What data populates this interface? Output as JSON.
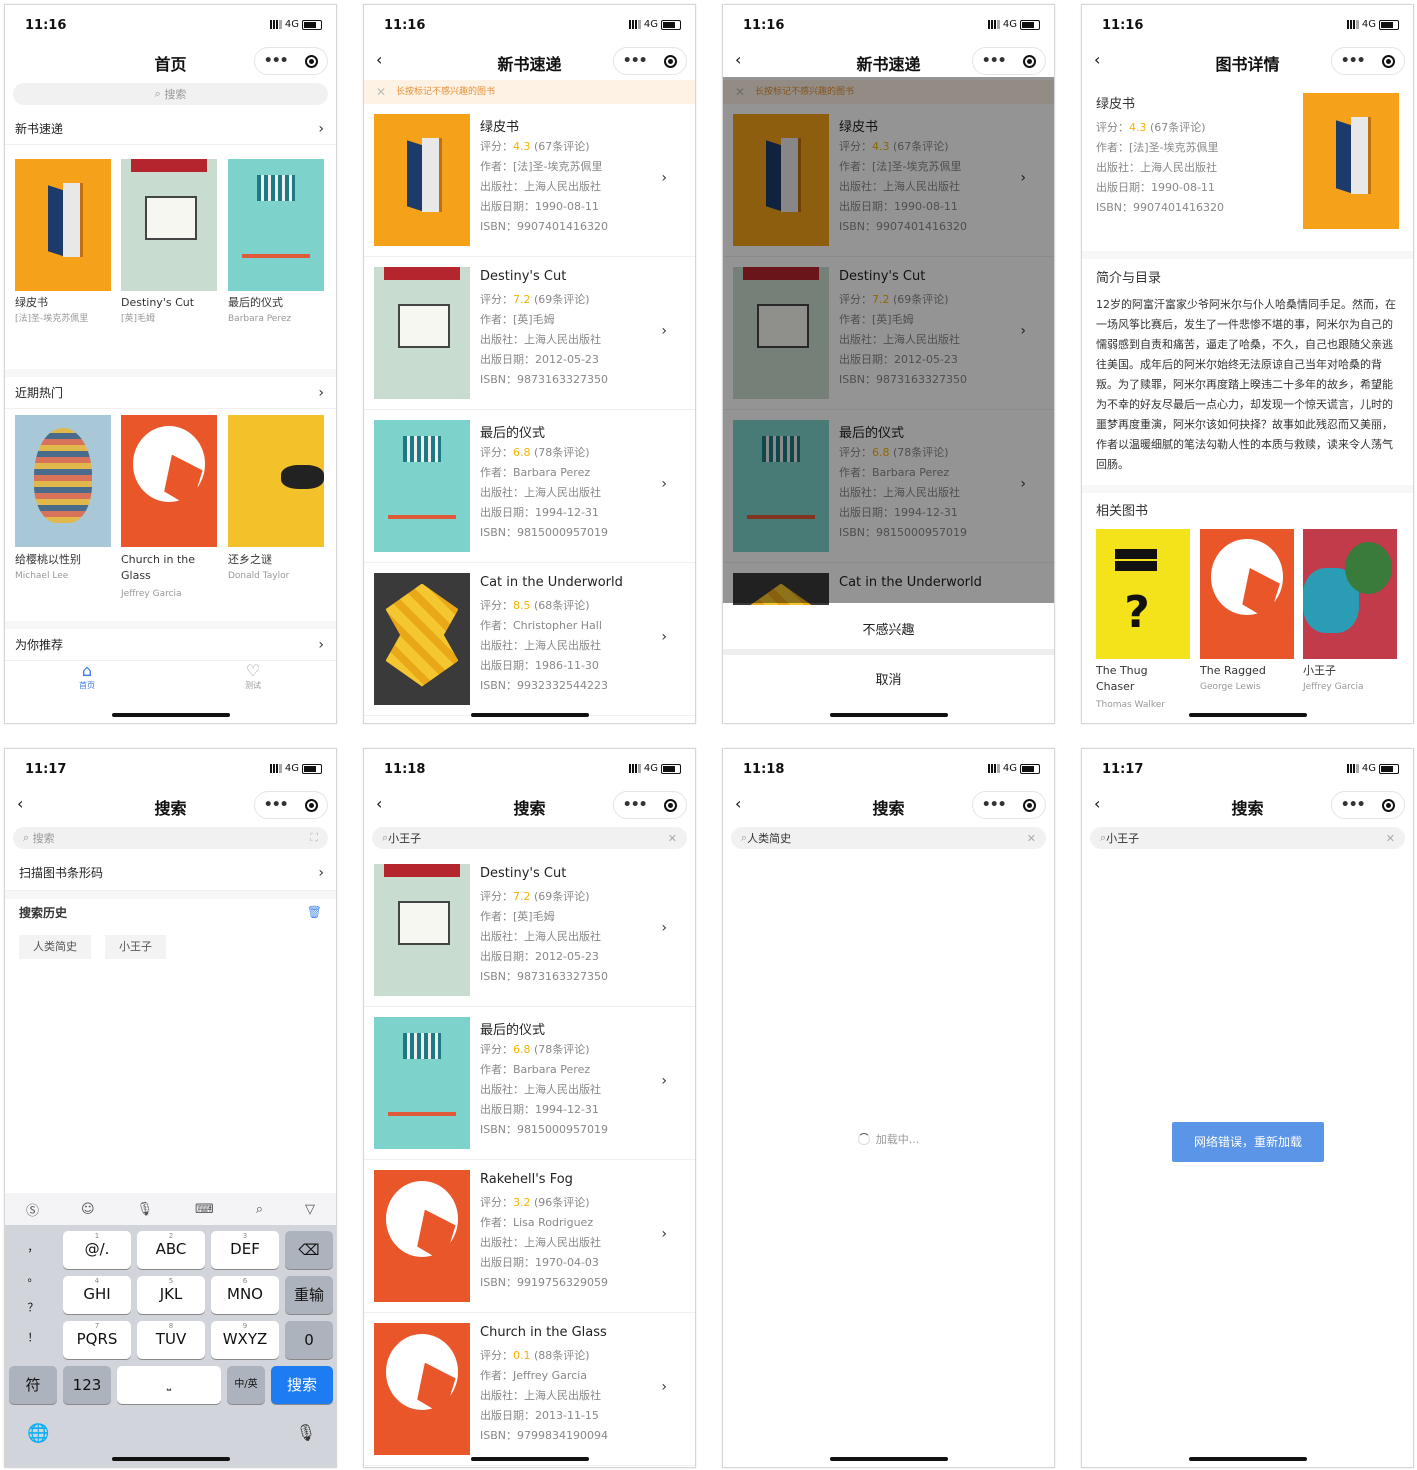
{
  "common": {
    "net": "4G",
    "more": "•••"
  },
  "p1": {
    "time": "11:16",
    "title": "首页",
    "search_placeholder": "搜索",
    "sec1": "新书速递",
    "sec2": "近期热门",
    "sec3": "为你推荐",
    "new": [
      {
        "title": "绿皮书",
        "author": "[法]圣-埃克苏佩里"
      },
      {
        "title": "Destiny's Cut",
        "author": "[英]毛姆"
      },
      {
        "title": "最后的仪式",
        "author": "Barbara Perez"
      }
    ],
    "hot": [
      {
        "title": "给樱桃以性别",
        "author": "Michael Lee"
      },
      {
        "title": "Church in the Glass",
        "author": "Jeffrey Garcia"
      },
      {
        "title": "还乡之谜",
        "author": "Donald Taylor"
      }
    ],
    "tabs": [
      "首页",
      "测试"
    ]
  },
  "p2": {
    "time": "11:16",
    "title": "新书速递",
    "notice": "长按标记不感兴趣的图书"
  },
  "list_new": [
    {
      "title": "绿皮书",
      "rate": "4.3",
      "reviews": "(67条评论)",
      "author": "[法]圣-埃克苏佩里",
      "publisher": "上海人民出版社",
      "date": "1990-08-11",
      "isbn": "9907401416320"
    },
    {
      "title": "Destiny's Cut",
      "rate": "7.2",
      "reviews": "(69条评论)",
      "author": "[英]毛姆",
      "publisher": "上海人民出版社",
      "date": "2012-05-23",
      "isbn": "9873163327350"
    },
    {
      "title": "最后的仪式",
      "rate": "6.8",
      "reviews": "(78条评论)",
      "author": "Barbara Perez",
      "publisher": "上海人民出版社",
      "date": "1994-12-31",
      "isbn": "9815000957019"
    },
    {
      "title": "Cat in the Underworld",
      "rate": "8.5",
      "reviews": "(68条评论)",
      "author": "Christopher Hall",
      "publisher": "上海人民出版社",
      "date": "1986-11-30",
      "isbn": "9932332544223"
    }
  ],
  "labels": {
    "rating": "评分：",
    "author": "作者：",
    "publisher": "出版社：",
    "date": "出版日期：",
    "isbn": "ISBN："
  },
  "p3": {
    "time": "11:16",
    "title": "新书速递",
    "sheet_item": "不感兴趣",
    "sheet_cancel": "取消"
  },
  "p4": {
    "time": "11:16",
    "title": "图书详情",
    "book": {
      "title": "绿皮书",
      "rating_label": "评分：",
      "rate": "4.3",
      "reviews": "(67条评论)",
      "author": "作者：[法]圣-埃克苏佩里",
      "publisher": "出版社：上海人民出版社",
      "date": "出版日期：1990-08-11",
      "isbn": "ISBN：9907401416320"
    },
    "intro_title": "简介与目录",
    "intro": "12岁的阿富汗富家少爷阿米尔与仆人哈桑情同手足。然而，在一场风筝比赛后，发生了一件悲惨不堪的事，阿米尔为自己的懦弱感到自责和痛苦，逼走了哈桑，不久，自己也跟随父亲逃往美国。成年后的阿米尔始终无法原谅自己当年对哈桑的背叛。为了赎罪，阿米尔再度踏上暌违二十多年的故乡，希望能为不幸的好友尽最后一点心力，却发现一个惊天谎言，儿时的噩梦再度重演，阿米尔该如何抉择？故事如此残忍而又美丽，作者以温暖细腻的笔法勾勒人性的本质与救赎，读来令人荡气回肠。",
    "related_title": "相关图书",
    "related": [
      {
        "title": "The Thug Chaser",
        "author": "Thomas Walker"
      },
      {
        "title": "The Ragged",
        "author": "George Lewis"
      },
      {
        "title": "小王子",
        "author": "Jeffrey Garcia"
      }
    ]
  },
  "p5": {
    "time": "11:17",
    "title": "搜索",
    "search_placeholder": "搜索",
    "scan": "扫描图书条形码",
    "history_title": "搜索历史",
    "history": [
      "人类简史",
      "小王子"
    ],
    "keys": {
      "r1": [
        "@/.",
        "ABC",
        "DEF"
      ],
      "r1n": [
        "1",
        "2",
        "3"
      ],
      "r2": [
        "GHI",
        "JKL",
        "MNO"
      ],
      "r2n": [
        "4",
        "5",
        "6"
      ],
      "r3": [
        "PQRS",
        "TUV",
        "WXYZ"
      ],
      "r3n": [
        "7",
        "8",
        "9"
      ],
      "side": [
        "，",
        "。",
        "？",
        "！"
      ],
      "retype": "重输",
      "zero": "0",
      "sym": "符",
      "num": "123",
      "lang": "中/英",
      "search": "搜索"
    }
  },
  "p6": {
    "time": "11:18",
    "title": "搜索",
    "query": "小王子"
  },
  "list_search": [
    {
      "title": "Destiny's Cut",
      "rate": "7.2",
      "reviews": "(69条评论)",
      "author": "[英]毛姆",
      "publisher": "上海人民出版社",
      "date": "2012-05-23",
      "isbn": "9873163327350"
    },
    {
      "title": "最后的仪式",
      "rate": "6.8",
      "reviews": "(78条评论)",
      "author": "Barbara Perez",
      "publisher": "上海人民出版社",
      "date": "1994-12-31",
      "isbn": "9815000957019"
    },
    {
      "title": "Rakehell's Fog",
      "rate": "3.2",
      "reviews": "(96条评论)",
      "author": "Lisa Rodriguez",
      "publisher": "上海人民出版社",
      "date": "1970-04-03",
      "isbn": "9919756329059"
    },
    {
      "title": "Church in the Glass",
      "rate": "0.1",
      "reviews": "(88条评论)",
      "author": "Jeffrey Garcia",
      "publisher": "上海人民出版社",
      "date": "2013-11-15",
      "isbn": "9799834190094"
    }
  ],
  "p7": {
    "time": "11:18",
    "title": "搜索",
    "query": "人类简史",
    "loading": "加载中..."
  },
  "p8": {
    "time": "11:17",
    "title": "搜索",
    "query": "小王子",
    "retry": "网络错误，重新加载"
  }
}
